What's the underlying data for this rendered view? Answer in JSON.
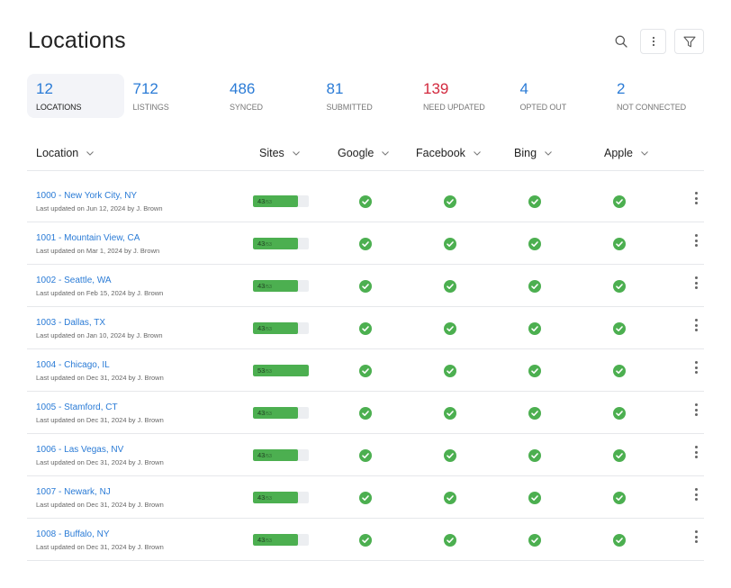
{
  "header": {
    "title": "Locations",
    "actions": [
      {
        "name": "search-button",
        "icon": "search-icon"
      },
      {
        "name": "more-options-button",
        "icon": "vertical-dots-icon"
      },
      {
        "name": "filter-button",
        "icon": "funnel-icon"
      }
    ]
  },
  "stats": [
    {
      "value": "12",
      "label": "LOCATIONS",
      "active": true,
      "color": "#2a7bd6"
    },
    {
      "value": "712",
      "label": "LISTINGS",
      "active": false,
      "color": "#2a7bd6"
    },
    {
      "value": "486",
      "label": "SYNCED",
      "active": false,
      "color": "#2a7bd6"
    },
    {
      "value": "81",
      "label": "SUBMITTED",
      "active": false,
      "color": "#2a7bd6"
    },
    {
      "value": "139",
      "label": "NEED UPDATED",
      "active": false,
      "color": "#d2283d"
    },
    {
      "value": "4",
      "label": "OPTED OUT",
      "active": false,
      "color": "#2a7bd6"
    },
    {
      "value": "2",
      "label": "NOT CONNECTED",
      "active": false,
      "color": "#2a7bd6"
    }
  ],
  "table": {
    "columns": [
      {
        "key": "location",
        "label": "Location"
      },
      {
        "key": "sites",
        "label": "Sites"
      },
      {
        "key": "google",
        "label": "Google"
      },
      {
        "key": "facebook",
        "label": "Facebook"
      },
      {
        "key": "bing",
        "label": "Bing"
      },
      {
        "key": "apple",
        "label": "Apple"
      }
    ],
    "rows": [
      {
        "name": "1000 - New York City, NY",
        "updated": "Last updated on Jun 12, 2024 by J. Brown",
        "sites": 43,
        "sites_total": 53,
        "google": "synced",
        "facebook": "synced",
        "bing": "synced",
        "apple": "synced"
      },
      {
        "name": "1001 - Mountain View, CA",
        "updated": "Last updated on Mar 1, 2024 by J. Brown",
        "sites": 43,
        "sites_total": 53,
        "google": "synced",
        "facebook": "synced",
        "bing": "synced",
        "apple": "synced"
      },
      {
        "name": "1002 - Seattle, WA",
        "updated": "Last updated on Feb 15, 2024 by J. Brown",
        "sites": 43,
        "sites_total": 53,
        "google": "synced",
        "facebook": "synced",
        "bing": "synced",
        "apple": "synced"
      },
      {
        "name": "1003 - Dallas, TX",
        "updated": "Last updated on Jan 10, 2024 by J. Brown",
        "sites": 43,
        "sites_total": 53,
        "google": "synced",
        "facebook": "synced",
        "bing": "synced",
        "apple": "synced"
      },
      {
        "name": "1004 - Chicago, IL",
        "updated": "Last updated on Dec 31, 2024 by J. Brown",
        "sites": 53,
        "sites_total": 53,
        "google": "synced",
        "facebook": "synced",
        "bing": "synced",
        "apple": "synced"
      },
      {
        "name": "1005 - Stamford, CT",
        "updated": "Last updated on Dec 31, 2024 by J. Brown",
        "sites": 43,
        "sites_total": 53,
        "google": "synced",
        "facebook": "synced",
        "bing": "synced",
        "apple": "synced"
      },
      {
        "name": "1006 - Las Vegas, NV",
        "updated": "Last updated on Dec 31, 2024 by J. Brown",
        "sites": 43,
        "sites_total": 53,
        "google": "synced",
        "facebook": "synced",
        "bing": "synced",
        "apple": "synced"
      },
      {
        "name": "1007 - Newark, NJ",
        "updated": "Last updated on Dec 31, 2024 by J. Brown",
        "sites": 43,
        "sites_total": 53,
        "google": "synced",
        "facebook": "synced",
        "bing": "synced",
        "apple": "synced"
      },
      {
        "name": "1008 - Buffalo, NY",
        "updated": "Last updated on Dec 31, 2024 by J. Brown",
        "sites": 43,
        "sites_total": 53,
        "google": "synced",
        "facebook": "synced",
        "bing": "synced",
        "apple": "synced"
      }
    ]
  },
  "colors": {
    "accent": "#2a7bd6",
    "alert": "#d2283d",
    "success": "#4caf50"
  }
}
